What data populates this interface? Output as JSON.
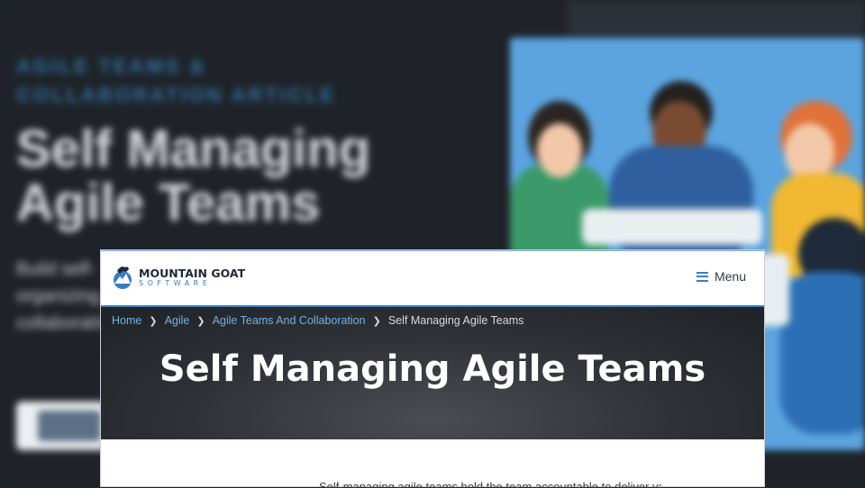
{
  "background": {
    "eyebrow": "AGILE TEAMS & COLLABORATION ARTICLE",
    "title": "Self Managing Agile Teams",
    "description": "Build self-organizing, collaborative"
  },
  "header": {
    "logo_name": "MOUNTAIN GOAT",
    "logo_sub": "SOFTWARE",
    "menu_label": "Menu"
  },
  "breadcrumb": {
    "items": [
      "Home",
      "Agile",
      "Agile Teams And Collaboration"
    ],
    "current": "Self Managing Agile Teams"
  },
  "hero": {
    "title": "Self Managing Agile Teams"
  },
  "article": {
    "intro": "Self-managing agile teams hold the team accountable to deliver value"
  },
  "colors": {
    "accent": "#3e7fbf",
    "link": "#6fb3ea",
    "hero_bg": "#2d3034",
    "illustration_bg": "#5ba4e0"
  }
}
